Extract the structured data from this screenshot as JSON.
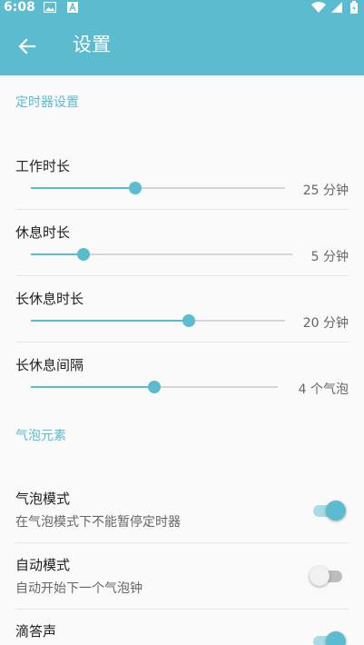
{
  "status_bar": {
    "time": "6:08",
    "left_icons": [
      "image-icon",
      "a-box-icon"
    ],
    "right_icons": [
      "wifi-icon",
      "signal-icon",
      "battery-icon"
    ]
  },
  "app_bar": {
    "title": "设置",
    "back_icon": "arrow-left-icon"
  },
  "colors": {
    "accent": "#5bbcd0",
    "toolbar_bg": "#5bbcd0",
    "background": "#fafafa"
  },
  "sections": {
    "timer": {
      "header": "定时器设置",
      "items": [
        {
          "title": "工作时长",
          "value": "25 分钟",
          "level": 0.41
        },
        {
          "title": "休息时长",
          "value": "5 分钟",
          "level": 0.2
        },
        {
          "title": "长休息时长",
          "value": "20 分钟",
          "level": 0.62
        },
        {
          "title": "长休息间隔",
          "value": "4 个气泡",
          "level": 0.5
        }
      ]
    },
    "bubble": {
      "header": "气泡元素",
      "items": [
        {
          "title": "气泡模式",
          "subtitle": "在气泡模式下不能暂停定时器",
          "checked": true
        },
        {
          "title": "自动模式",
          "subtitle": "自动开始下一个气泡钟",
          "checked": false
        },
        {
          "title": "滴答声",
          "checked": true
        }
      ]
    }
  }
}
